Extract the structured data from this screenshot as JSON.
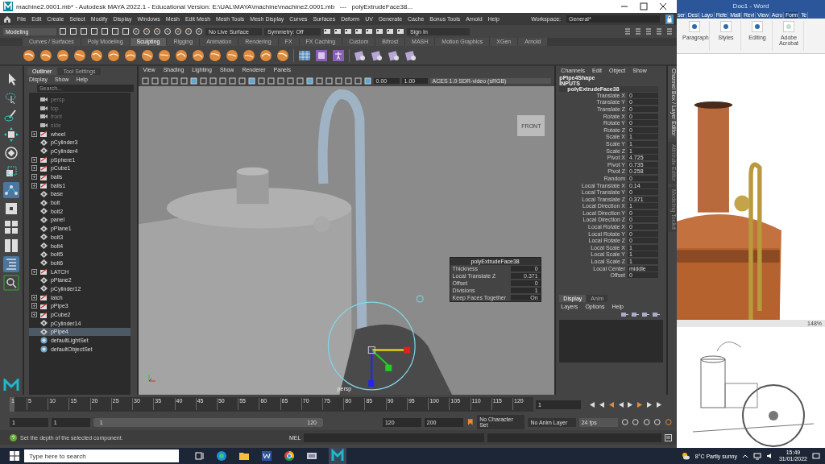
{
  "window": {
    "title": "machine2.0001.mb* - Autodesk MAYA 2022.1 - Educational Version: E:\\UAL\\MAYA\\machine\\machine2.0001.mb   ---   polyExtrudeFace38..."
  },
  "menu": [
    "File",
    "Edit",
    "Create",
    "Select",
    "Modify",
    "Display",
    "Windows",
    "Mesh",
    "Edit Mesh",
    "Mesh Tools",
    "Mesh Display",
    "Curves",
    "Surfaces",
    "Deform",
    "UV",
    "Generate",
    "Cache",
    "Bonus Tools",
    "Arnold",
    "Help"
  ],
  "workspace": {
    "label": "Workspace:",
    "value": "General*"
  },
  "status_line": {
    "mode": "Modeling",
    "live_surface": "No Live Surface",
    "symmetry": "Symmetry: Off",
    "sign_in": "Sign In"
  },
  "shelf_tabs": [
    {
      "label": "Curves / Surfaces",
      "selected": false
    },
    {
      "label": "Poly Modeling",
      "selected": false
    },
    {
      "label": "Sculpting",
      "selected": true
    },
    {
      "label": "Rigging",
      "selected": false
    },
    {
      "label": "Animation",
      "selected": false
    },
    {
      "label": "Rendering",
      "selected": false
    },
    {
      "label": "FX",
      "selected": false
    },
    {
      "label": "FX Caching",
      "selected": false
    },
    {
      "label": "Custom",
      "selected": false
    },
    {
      "label": "Bifrost",
      "selected": false
    },
    {
      "label": "MASH",
      "selected": false
    },
    {
      "label": "Motion Graphics",
      "selected": false
    },
    {
      "label": "XGen",
      "selected": false
    },
    {
      "label": "Arnold",
      "selected": false
    }
  ],
  "toolbox": [
    {
      "kind": "select",
      "selected": false
    },
    {
      "kind": "lasso",
      "selected": false
    },
    {
      "kind": "paint",
      "selected": false
    },
    {
      "kind": "move",
      "selected": false
    },
    {
      "kind": "rotate",
      "selected": false
    },
    {
      "kind": "scale",
      "selected": false
    },
    {
      "kind": "soft",
      "selected": true
    },
    {
      "kind": "single",
      "selected": false
    },
    {
      "kind": "four",
      "selected": false
    },
    {
      "kind": "two",
      "selected": false
    },
    {
      "kind": "outliner",
      "selected": true
    },
    {
      "kind": "search",
      "selected": false
    }
  ],
  "outliner": {
    "tabs": [
      {
        "label": "Outliner",
        "selected": true
      },
      {
        "label": "Tool Settings",
        "selected": false
      }
    ],
    "menu": [
      "Display",
      "Show",
      "Help"
    ],
    "search": {
      "placeholder": "Search..."
    },
    "items": [
      {
        "label": "persp",
        "kind": "camera",
        "selected": false
      },
      {
        "label": "top",
        "kind": "camera",
        "selected": false
      },
      {
        "label": "front",
        "kind": "camera",
        "selected": false
      },
      {
        "label": "side",
        "kind": "camera",
        "selected": false
      },
      {
        "label": "wheel",
        "kind": "group",
        "selected": false
      },
      {
        "label": "pCylinder3",
        "kind": "mesh",
        "selected": false
      },
      {
        "label": "pCylinder4",
        "kind": "mesh",
        "selected": false
      },
      {
        "label": "pSphere1",
        "kind": "group",
        "selected": false
      },
      {
        "label": "pCube1",
        "kind": "group",
        "selected": false
      },
      {
        "label": "balls",
        "kind": "group",
        "selected": false
      },
      {
        "label": "balls1",
        "kind": "group",
        "selected": false
      },
      {
        "label": "base",
        "kind": "mesh",
        "selected": false
      },
      {
        "label": "bolt",
        "kind": "mesh",
        "selected": false
      },
      {
        "label": "bolt2",
        "kind": "mesh",
        "selected": false
      },
      {
        "label": "panel",
        "kind": "mesh",
        "selected": false
      },
      {
        "label": "pPlane1",
        "kind": "mesh",
        "selected": false
      },
      {
        "label": "bolt3",
        "kind": "mesh",
        "selected": false
      },
      {
        "label": "bolt4",
        "kind": "mesh",
        "selected": false
      },
      {
        "label": "bolt5",
        "kind": "mesh",
        "selected": false
      },
      {
        "label": "bolt6",
        "kind": "mesh",
        "selected": false
      },
      {
        "label": "LATCH",
        "kind": "group",
        "selected": false
      },
      {
        "label": "pPlane2",
        "kind": "mesh",
        "selected": false
      },
      {
        "label": "pCylinder12",
        "kind": "mesh",
        "selected": false
      },
      {
        "label": "latch",
        "kind": "group",
        "selected": false
      },
      {
        "label": "pPipe3",
        "kind": "group",
        "selected": false
      },
      {
        "label": "pCube2",
        "kind": "group",
        "selected": false
      },
      {
        "label": "pCylinder14",
        "kind": "mesh",
        "selected": false
      },
      {
        "label": "pPipe4",
        "kind": "mesh",
        "selected": true
      },
      {
        "label": "defaultLightSet",
        "kind": "set",
        "selected": false
      },
      {
        "label": "defaultObjectSet",
        "kind": "set",
        "selected": false
      }
    ]
  },
  "viewport": {
    "menu": [
      "View",
      "Shading",
      "Lighting",
      "Show",
      "Renderer",
      "Panels"
    ],
    "exposure": "0.00",
    "gamma": "1.00",
    "color_space": "ACES 1.0 SDR-video (sRGB)",
    "view_cube": "FRONT",
    "camera": "persp",
    "panel": {
      "title": "polyExtrudeFace38",
      "rows": [
        {
          "name": "Thickness",
          "value": "0"
        },
        {
          "name": "Local Translate Z",
          "value": "0.371"
        },
        {
          "name": "Offset",
          "value": "0"
        },
        {
          "name": "Divisions",
          "value": "1"
        },
        {
          "name": "Keep Faces Together",
          "value": "On"
        }
      ]
    }
  },
  "channel_box": {
    "menu": [
      "Channels",
      "Edit",
      "Object",
      "Show"
    ],
    "shape": "pPipe4Shape",
    "inputs": "INPUTS",
    "node": "polyExtrudeFace38",
    "attributes": [
      {
        "name": "Translate X",
        "value": "0"
      },
      {
        "name": "Translate Y",
        "value": "0"
      },
      {
        "name": "Translate Z",
        "value": "0"
      },
      {
        "name": "Rotate X",
        "value": "0"
      },
      {
        "name": "Rotate Y",
        "value": "0"
      },
      {
        "name": "Rotate Z",
        "value": "0"
      },
      {
        "name": "Scale X",
        "value": "1"
      },
      {
        "name": "Scale Y",
        "value": "1"
      },
      {
        "name": "Scale Z",
        "value": "1"
      },
      {
        "name": "Pivot X",
        "value": "4.725"
      },
      {
        "name": "Pivot Y",
        "value": "0.735"
      },
      {
        "name": "Pivot Z",
        "value": "0.258"
      },
      {
        "name": "Random",
        "value": "0"
      },
      {
        "name": "Local Translate X",
        "value": "0.14"
      },
      {
        "name": "Local Translate Y",
        "value": "0"
      },
      {
        "name": "Local Translate Z",
        "value": "0.371"
      },
      {
        "name": "Local Direction X",
        "value": "1"
      },
      {
        "name": "Local Direction Y",
        "value": "0"
      },
      {
        "name": "Local Direction Z",
        "value": "0"
      },
      {
        "name": "Local Rotate X",
        "value": "0"
      },
      {
        "name": "Local Rotate Y",
        "value": "0"
      },
      {
        "name": "Local Rotate Z",
        "value": "0"
      },
      {
        "name": "Local Scale X",
        "value": "1"
      },
      {
        "name": "Local Scale Y",
        "value": "1"
      },
      {
        "name": "Local Scale Z",
        "value": "1"
      },
      {
        "name": "Local Center",
        "value": "middle"
      },
      {
        "name": "Offset",
        "value": "0"
      }
    ],
    "layer_tabs": [
      {
        "label": "Display",
        "selected": true
      },
      {
        "label": "Anim",
        "selected": false
      }
    ],
    "layer_menu": [
      "Layers",
      "Options",
      "Help"
    ]
  },
  "side_tabs": [
    {
      "label": "Channel Box / Layer Editor",
      "selected": true
    },
    {
      "label": "Attribute Editor",
      "selected": false
    },
    {
      "label": "Modeling Toolkit",
      "selected": false
    }
  ],
  "timeline": {
    "level": 0,
    "ticks": [
      "1",
      "5",
      "10",
      "15",
      "20",
      "25",
      "30",
      "35",
      "40",
      "45",
      "50",
      "55",
      "60",
      "65",
      "70",
      "75",
      "80",
      "85",
      "90",
      "95",
      "100",
      "105",
      "110",
      "115",
      "120"
    ],
    "current_frame": "1"
  },
  "range": {
    "level": 1,
    "start": "1",
    "playback_start": "1",
    "slider_start": "1",
    "slider_end": "120",
    "playback_end": "120",
    "end": "200",
    "character_set": "No Character Set",
    "anim_layer": "No Anim Layer",
    "fps": "24 fps"
  },
  "help_line": "Set the depth of the selected component.",
  "command_line": {
    "label": "MEL"
  },
  "word": {
    "title": "Doc1 - Word",
    "tabs": [
      {
        "label": "ser",
        "selected": false
      },
      {
        "label": "Desi",
        "selected": false
      },
      {
        "label": "Layo",
        "selected": false
      },
      {
        "label": "Refe",
        "selected": false
      },
      {
        "label": "Maili",
        "selected": false
      },
      {
        "label": "Revi",
        "selected": false
      },
      {
        "label": "View",
        "selected": false
      },
      {
        "label": "Acro",
        "selected": false
      },
      {
        "label": "Form",
        "selected": true
      },
      {
        "label": "Te",
        "selected": false
      }
    ],
    "groups": [
      "Paragraph",
      "Styles",
      "Editing",
      "Adobe Acrobat"
    ],
    "zoom": "148%"
  },
  "taskbar": {
    "search": {
      "placeholder": "Type here to search"
    },
    "weather": "8°C  Partly sunny",
    "time": "15:49",
    "date": "31/01/2022"
  }
}
